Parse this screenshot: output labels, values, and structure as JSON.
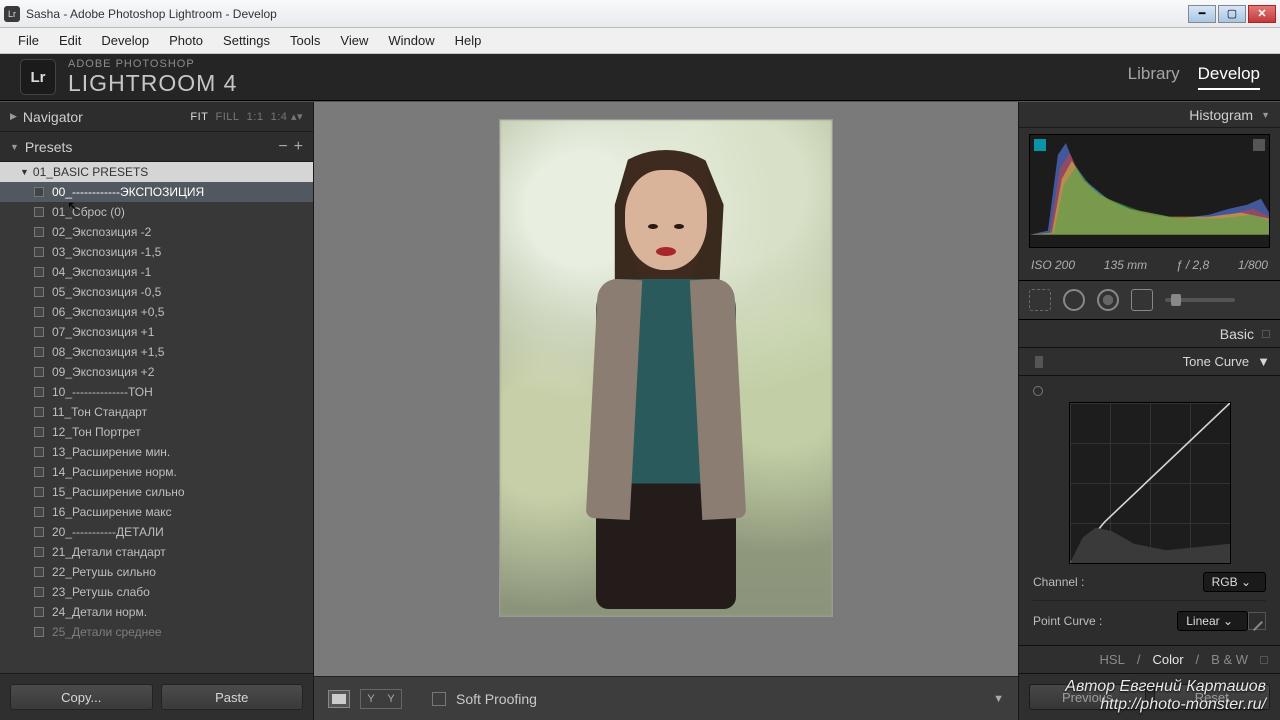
{
  "window": {
    "title": "Sasha - Adobe Photoshop Lightroom - Develop"
  },
  "menu": [
    "File",
    "Edit",
    "Develop",
    "Photo",
    "Settings",
    "Tools",
    "View",
    "Window",
    "Help"
  ],
  "brand": {
    "logo": "Lr",
    "line1": "ADOBE PHOTOSHOP",
    "line2": "LIGHTROOM 4"
  },
  "modules": {
    "library": "Library",
    "develop": "Develop"
  },
  "leftPanel": {
    "navigator": {
      "title": "Navigator",
      "fit": "FIT",
      "fill": "FILL",
      "one": "1:1",
      "ratio": "1:4"
    },
    "presets": {
      "title": "Presets",
      "folder": "01_BASIC PRESETS",
      "items": [
        "00_------------ЭКСПОЗИЦИЯ",
        "01_Сброс (0)",
        "02_Экспозиция -2",
        "03_Экспозиция -1,5",
        "04_Экспозиция -1",
        "05_Экспозиция -0,5",
        "06_Экспозиция +0,5",
        "07_Экспозиция +1",
        "08_Экспозиция +1,5",
        "09_Экспозиция +2",
        "10_--------------ТОН",
        "11_Тон Стандарт",
        "12_Тон Портрет",
        "13_Расширение мин.",
        "14_Расширение норм.",
        "15_Расширение сильно",
        "16_Расширение макс",
        "20_-----------ДЕТАЛИ",
        "21_Детали стандарт",
        "22_Ретушь сильно",
        "23_Ретушь слабо",
        "24_Детали норм.",
        "25_Детали среднее"
      ]
    },
    "buttons": {
      "copy": "Copy...",
      "paste": "Paste"
    }
  },
  "centerBottom": {
    "softProofing": "Soft Proofing"
  },
  "rightPanel": {
    "histogram": {
      "title": "Histogram",
      "iso": "ISO 200",
      "focal": "135 mm",
      "aperture": "ƒ / 2,8",
      "shutter": "1/800"
    },
    "basic": "Basic",
    "toneCurve": {
      "title": "Tone Curve",
      "channelLabel": "Channel :",
      "channel": "RGB",
      "pointCurveLabel": "Point Curve :",
      "pointCurve": "Linear"
    },
    "hsl": {
      "hsl": "HSL",
      "color": "Color",
      "bw": "B & W"
    },
    "buttons": {
      "previous": "Previous",
      "reset": "Reset"
    }
  },
  "watermark": {
    "line1": "Автор Евгений Карташов",
    "line2": "http://photo-monster.ru/"
  }
}
